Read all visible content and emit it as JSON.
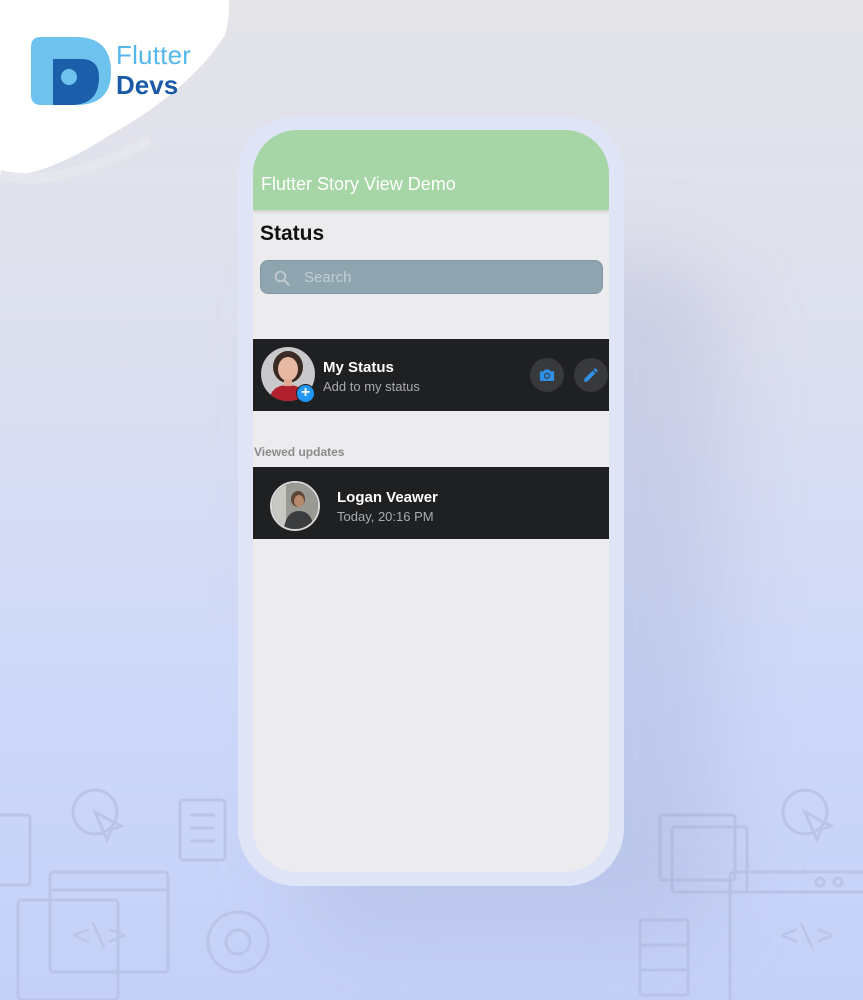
{
  "brand": {
    "line1": "Flutter",
    "line2": "Devs"
  },
  "app": {
    "title": "Flutter Story View Demo"
  },
  "status_page": {
    "heading": "Status",
    "search": {
      "placeholder": "Search",
      "icon": "search-icon"
    },
    "my_status": {
      "name": "My Status",
      "subtitle": "Add to my status",
      "badge_icon": "plus-icon",
      "actions": [
        {
          "icon": "camera-icon"
        },
        {
          "icon": "pencil-icon"
        }
      ]
    },
    "viewed_section_label": "Viewed updates",
    "viewed_updates": [
      {
        "name": "Logan Veawer",
        "time": "Today, 20:16 PM"
      }
    ]
  },
  "colors": {
    "appbar": "#a6d5a6",
    "row_bg": "#1f2022",
    "accent": "#2196f3",
    "search_bg": "#8ea4ae"
  }
}
